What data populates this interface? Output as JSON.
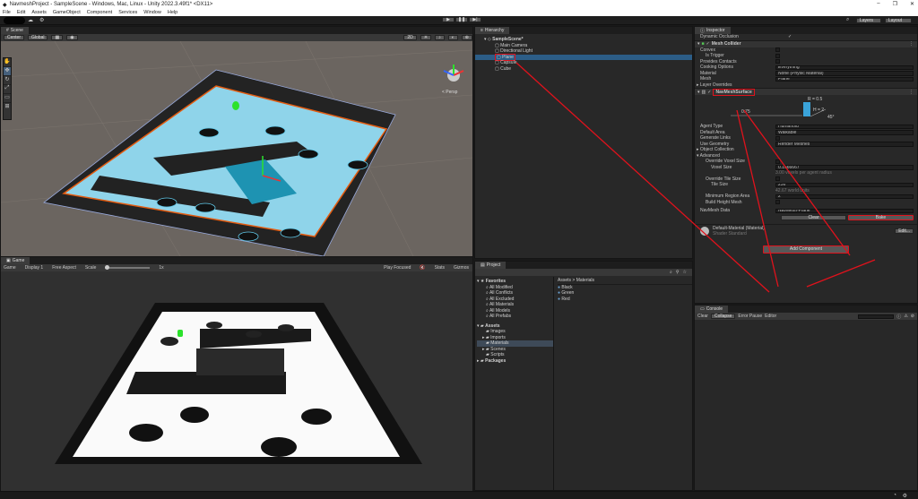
{
  "window": {
    "title": "NavmeshProject - SampleScene - Windows, Mac, Linux - Unity 2022.3.49f1* <DX11>",
    "controls": [
      "–",
      "❐",
      "✕"
    ]
  },
  "menu": [
    "File",
    "Edit",
    "Assets",
    "GameObject",
    "Component",
    "Services",
    "Window",
    "Help"
  ],
  "toolbar": {
    "layers": "Layers",
    "layout": "Layout"
  },
  "scene": {
    "tab": "Scene",
    "pivot": "Center",
    "space": "Global",
    "mode2d": "2D",
    "persp": "< Persp"
  },
  "game": {
    "tab": "Game",
    "mode": "Game",
    "display": "Display 1",
    "aspect": "Free Aspect",
    "scale_label": "Scale",
    "scale_value": "1x",
    "play_focused": "Play Focused",
    "stats": "Stats",
    "gizmos": "Gizmos"
  },
  "hierarchy": {
    "tab": "Hierarchy",
    "scene": "SampleScene*",
    "items": [
      "Main Camera",
      "Directional Light",
      "Plane",
      "Capsule",
      "Cube"
    ]
  },
  "project": {
    "tab": "Project",
    "favorites": "Favorites",
    "fav_items": [
      "All Modified",
      "All Conflicts",
      "All Excluded",
      "All Materials",
      "All Models",
      "All Prefabs"
    ],
    "assets": "Assets",
    "asset_items": [
      "Images",
      "Imports",
      "Materials",
      "Scenes",
      "Scripts"
    ],
    "packages": "Packages",
    "breadcrumb": "Assets > Materials",
    "materials": [
      "Black",
      "Green",
      "Red"
    ]
  },
  "inspector": {
    "tab": "Inspector",
    "dynamic_occlusion": "Dynamic Occlusion",
    "mesh_collider": {
      "title": "Mesh Collider",
      "rows": [
        {
          "label": "Convex",
          "value": ""
        },
        {
          "label": "Is Trigger",
          "value": ""
        },
        {
          "label": "Provides Contacts",
          "value": ""
        },
        {
          "label": "Cooking Options",
          "value": "Everything"
        },
        {
          "label": "Material",
          "value": "None (Physic Material)"
        },
        {
          "label": "Mesh",
          "value": "Plane"
        }
      ]
    },
    "layer_overrides": "Layer Overrides",
    "navmesh": {
      "title": "NavMeshSurface",
      "r": "R = 0.5",
      "h": "H = 2",
      "step": "0.75",
      "slope": "45°",
      "rows": [
        {
          "label": "Agent Type",
          "value": "Humanoid"
        },
        {
          "label": "Default Area",
          "value": "Walkable"
        },
        {
          "label": "Generate Links",
          "value": ""
        },
        {
          "label": "Use Geometry",
          "value": "Render Meshes"
        }
      ],
      "object_collection": "Object Collection",
      "advanced": "Advanced",
      "adv_rows": [
        {
          "label": "Override Voxel Size",
          "value": ""
        },
        {
          "label": "Voxel Size",
          "value": "0.1666667"
        },
        {
          "label": "",
          "value": "3.00 voxels per agent radius"
        },
        {
          "label": "Override Tile Size",
          "value": ""
        },
        {
          "label": "Tile Size",
          "value": "256"
        },
        {
          "label": "",
          "value": "42.67 world units"
        },
        {
          "label": "Minimum Region Area",
          "value": "2"
        },
        {
          "label": "Build Height Mesh",
          "value": ""
        }
      ],
      "data_label": "NavMesh Data",
      "data_value": "NavMesh-Plane",
      "clear": "Clear",
      "bake": "Bake"
    },
    "material": {
      "name": "Default-Material (Material)",
      "shader_label": "Shader",
      "shader_value": "Standard",
      "edit": "Edit..."
    },
    "add_component": "Add Component"
  },
  "console": {
    "tab": "Console",
    "buttons": [
      "Clear",
      "Collapse",
      "Error Pause",
      "Editor"
    ]
  }
}
